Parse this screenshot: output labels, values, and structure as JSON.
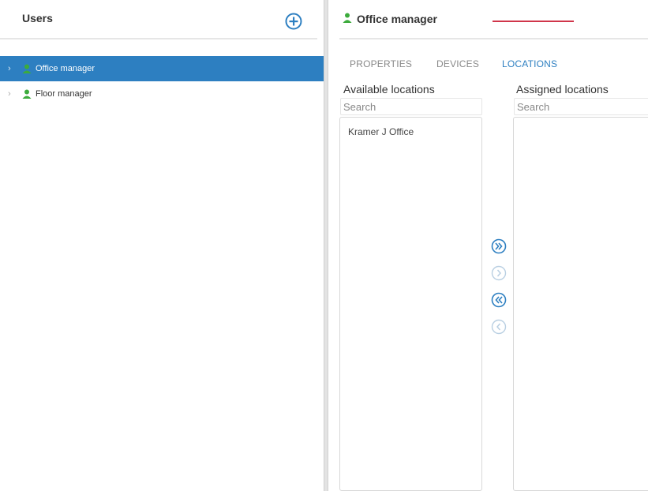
{
  "left_panel": {
    "title": "Users",
    "users": [
      {
        "label": "Office manager",
        "selected": true
      },
      {
        "label": "Floor manager",
        "selected": false
      }
    ]
  },
  "right_panel": {
    "title": "Office manager",
    "tabs": [
      {
        "label": "PROPERTIES",
        "active": false
      },
      {
        "label": "DEVICES",
        "active": false
      },
      {
        "label": "LOCATIONS",
        "active": true
      }
    ],
    "available": {
      "label": "Available locations",
      "search_placeholder": "Search",
      "items": [
        "Kramer J Office"
      ]
    },
    "assigned": {
      "label": "Assigned locations",
      "search_placeholder": "Search",
      "items": []
    }
  },
  "icons": {
    "add": "plus-circle-icon",
    "user": "user-icon",
    "tree_expand": "chevron-right-icon",
    "move_all_right": "double-chevron-right-circle-icon",
    "move_right": "chevron-right-circle-icon",
    "move_all_left": "double-chevron-left-circle-icon",
    "move_left": "chevron-left-circle-icon"
  },
  "colors": {
    "accent": "#2d7fc1",
    "user_icon": "#3cab3c",
    "tab_underline": "#d0354a"
  }
}
